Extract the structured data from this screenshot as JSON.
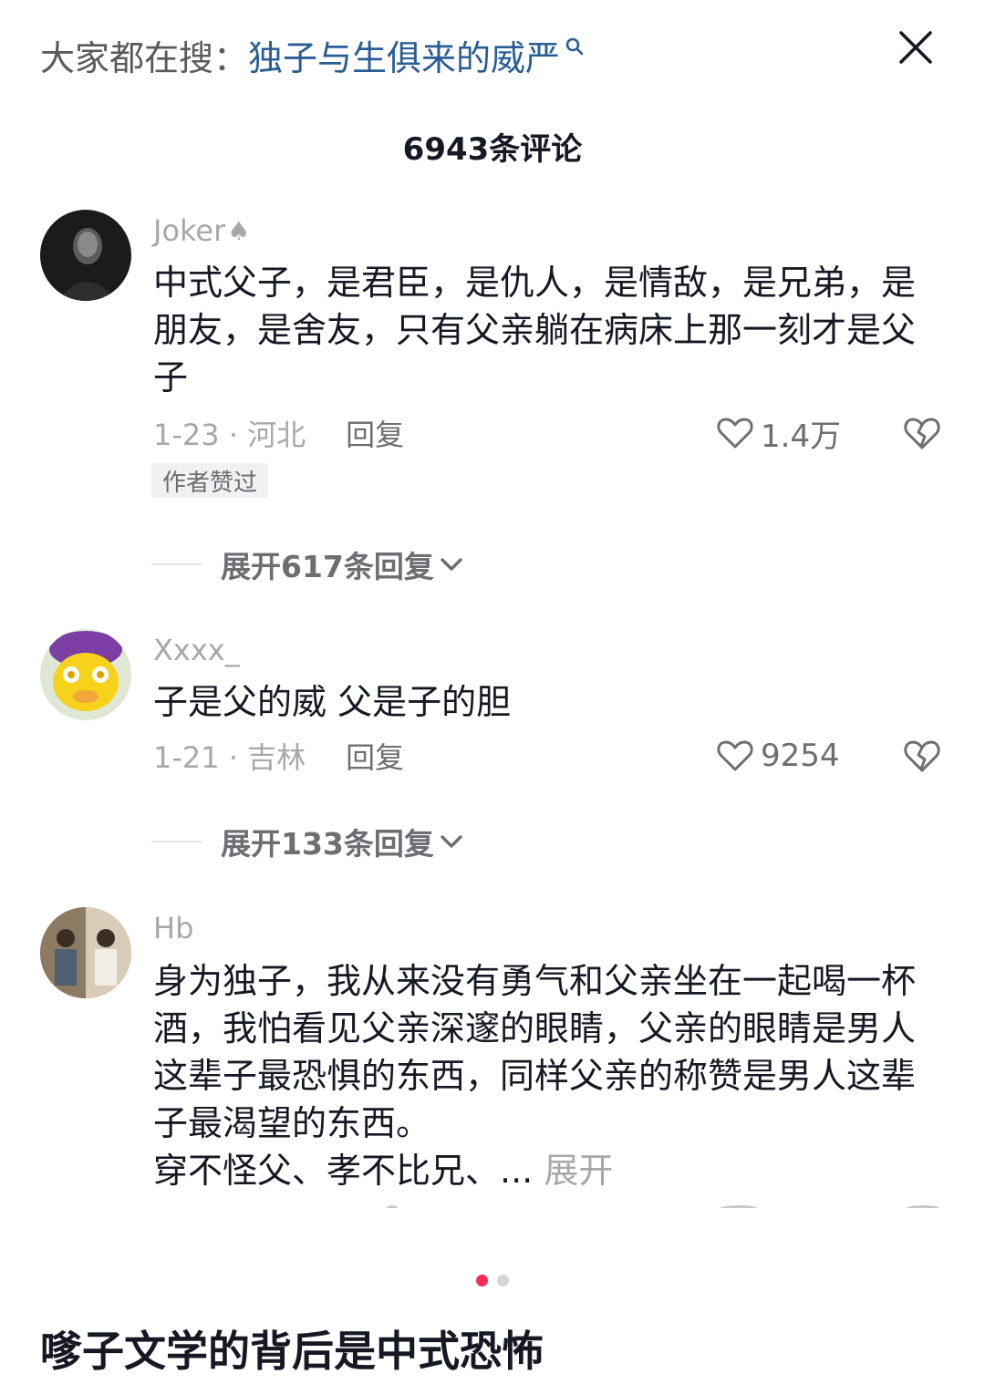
{
  "search": {
    "prefix": "大家都在搜：",
    "term": "独子与生俱来的威严"
  },
  "header": {
    "comment_count": "6943条评论"
  },
  "comments": [
    {
      "username": "Joker",
      "username_icon": "spade-icon",
      "text": "中式父子，是君臣，是仇人，是情敌，是兄弟，是朋友，是舍友，只有父亲躺在病床上那一刻才是父子",
      "date_location": "1-23 · 河北",
      "reply_label": "回复",
      "likes": "1.4万",
      "badge": "作者赞过",
      "expand_label": "展开617条回复"
    },
    {
      "username": "Xxxx_",
      "text": "子是父的威 父是子的胆",
      "date_location": "1-21 · 吉林",
      "reply_label": "回复",
      "likes": "9254",
      "expand_label": "展开133条回复"
    },
    {
      "username": "Hb",
      "text": "身为独子，我从来没有勇气和父亲坐在一起喝一杯酒，我怕看见父亲深邃的眼睛，父亲的眼睛是男人这辈子最恐惧的东西，同样父亲的称赞是男人这辈子最渴望的东西。",
      "text_line2": "穿不怪父、孝不比兄、...",
      "more_label": "展开"
    }
  ],
  "pager": {
    "total": 2,
    "active": 1
  },
  "post": {
    "title": "嗲子文学的背后是中式恐怖"
  },
  "colors": {
    "search_term": "#2a5d95",
    "pager_active": "#fe2c55",
    "meta_gray": "#a8a8ac"
  }
}
